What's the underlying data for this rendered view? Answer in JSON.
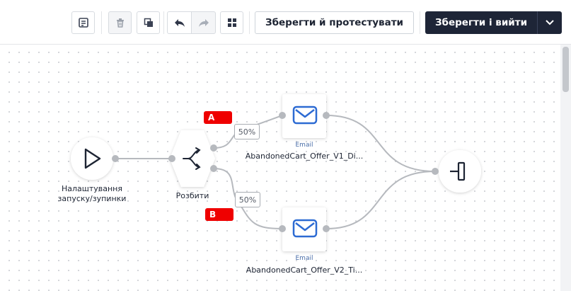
{
  "toolbar": {
    "notes_icon": "notes-icon",
    "delete_icon": "trash-icon",
    "copy_icon": "copy-icon",
    "undo_icon": "undo-icon",
    "redo_icon": "redo-icon",
    "grid_icon": "grid-icon",
    "save_test_label": "Зберегти й протестувати",
    "save_exit_label": "Зберегти і вийти"
  },
  "flow": {
    "start": {
      "label_line1": "Налаштування",
      "label_line2": "запуску/зупинки"
    },
    "split": {
      "label": "Розбити"
    },
    "branch_a": {
      "tag": "A",
      "percent": "50%"
    },
    "branch_b": {
      "tag": "B",
      "percent": "50%"
    },
    "email_a": {
      "type": "Email",
      "name": "AbandonedCart_Offer_V1_Di..."
    },
    "email_b": {
      "type": "Email",
      "name": "AbandonedCart_Offer_V2_Ti..."
    }
  },
  "colors": {
    "accent_blue": "#2d6bd3",
    "tag_red": "#ef0000",
    "dark_button": "#1e2537"
  }
}
